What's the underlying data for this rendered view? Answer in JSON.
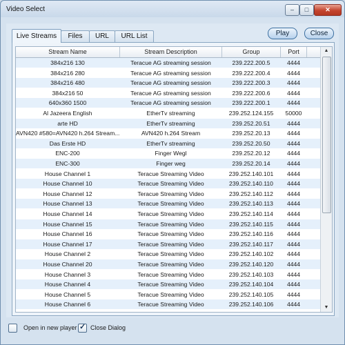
{
  "window": {
    "title": "Video Select"
  },
  "caption_buttons": {
    "minimize": "–",
    "maximize": "□",
    "close": "✕"
  },
  "tabs": [
    {
      "label": "Live Streams",
      "active": true
    },
    {
      "label": "Files",
      "active": false
    },
    {
      "label": "URL",
      "active": false
    },
    {
      "label": "URL List",
      "active": false
    }
  ],
  "buttons": {
    "play": "Play",
    "close": "Close"
  },
  "table": {
    "columns": [
      "Stream Name",
      "Stream Description",
      "Group",
      "Port"
    ],
    "rows": [
      [
        "384x216 130",
        "Teracue AG streaming session",
        "239.222.200.5",
        "4444"
      ],
      [
        "384x216 280",
        "Teracue AG streaming session",
        "239.222.200.4",
        "4444"
      ],
      [
        "384x216 480",
        "Teracue AG streaming session",
        "239.222.200.3",
        "4444"
      ],
      [
        "384x216 50",
        "Teracue AG streaming session",
        "239.222.200.6",
        "4444"
      ],
      [
        "640x360 1500",
        "Teracue AG streaming session",
        "239.222.200.1",
        "4444"
      ],
      [
        "Al Jazeera English",
        "EtherTv streaming",
        "239.252.124.155",
        "50000"
      ],
      [
        "arte HD",
        "EtherTv streaming",
        "239.252.20.51",
        "4444"
      ],
      [
        "AVN420 #580=AVN420 h.264 Stream...",
        "AVN420 h.264 Stream",
        "239.252.20.13",
        "4444"
      ],
      [
        "Das Erste HD",
        "EtherTv streaming",
        "239.252.20.50",
        "4444"
      ],
      [
        "ENC-200",
        "Finger Wegl",
        "239.252.20.12",
        "4444"
      ],
      [
        "ENC-300",
        "Finger weg",
        "239.252.20.14",
        "4444"
      ],
      [
        "House Channel 1",
        "Teracue Streaming Video",
        "239.252.140.101",
        "4444"
      ],
      [
        "House Channel 10",
        "Teracue Streaming Video",
        "239.252.140.110",
        "4444"
      ],
      [
        "House Channel 12",
        "Teracue Streaming Video",
        "239.252.140.112",
        "4444"
      ],
      [
        "House Channel 13",
        "Teracue Streaming Video",
        "239.252.140.113",
        "4444"
      ],
      [
        "House Channel 14",
        "Teracue Streaming Video",
        "239.252.140.114",
        "4444"
      ],
      [
        "House Channel 15",
        "Teracue Streaming Video",
        "239.252.140.115",
        "4444"
      ],
      [
        "House Channel 16",
        "Teracue Streaming Video",
        "239.252.140.116",
        "4444"
      ],
      [
        "House Channel 17",
        "Teracue Streaming Video",
        "239.252.140.117",
        "4444"
      ],
      [
        "House Channel 2",
        "Teracue Streaming Video",
        "239.252.140.102",
        "4444"
      ],
      [
        "House Channel 20",
        "Teracue Streaming Video",
        "239.252.140.120",
        "4444"
      ],
      [
        "House Channel 3",
        "Teracue Streaming Video",
        "239.252.140.103",
        "4444"
      ],
      [
        "House Channel 4",
        "Teracue Streaming Video",
        "239.252.140.104",
        "4444"
      ],
      [
        "House Channel 5",
        "Teracue Streaming Video",
        "239.252.140.105",
        "4444"
      ],
      [
        "House Channel 6",
        "Teracue Streaming Video",
        "239.252.140.106",
        "4444"
      ]
    ]
  },
  "footer": {
    "open_in_new_player": {
      "label": "Open in new player",
      "checked": false
    },
    "close_dialog": {
      "label": "Close Dialog",
      "checked": true
    }
  },
  "colors": {
    "row_alt": "#e5f0fb",
    "button_border": "#3c6f9f",
    "close_caption": "#c4442e"
  },
  "icons": {
    "scroll_up": "scroll-up-arrow-icon",
    "scroll_down": "scroll-down-arrow-icon",
    "check": "checkmark-icon"
  }
}
